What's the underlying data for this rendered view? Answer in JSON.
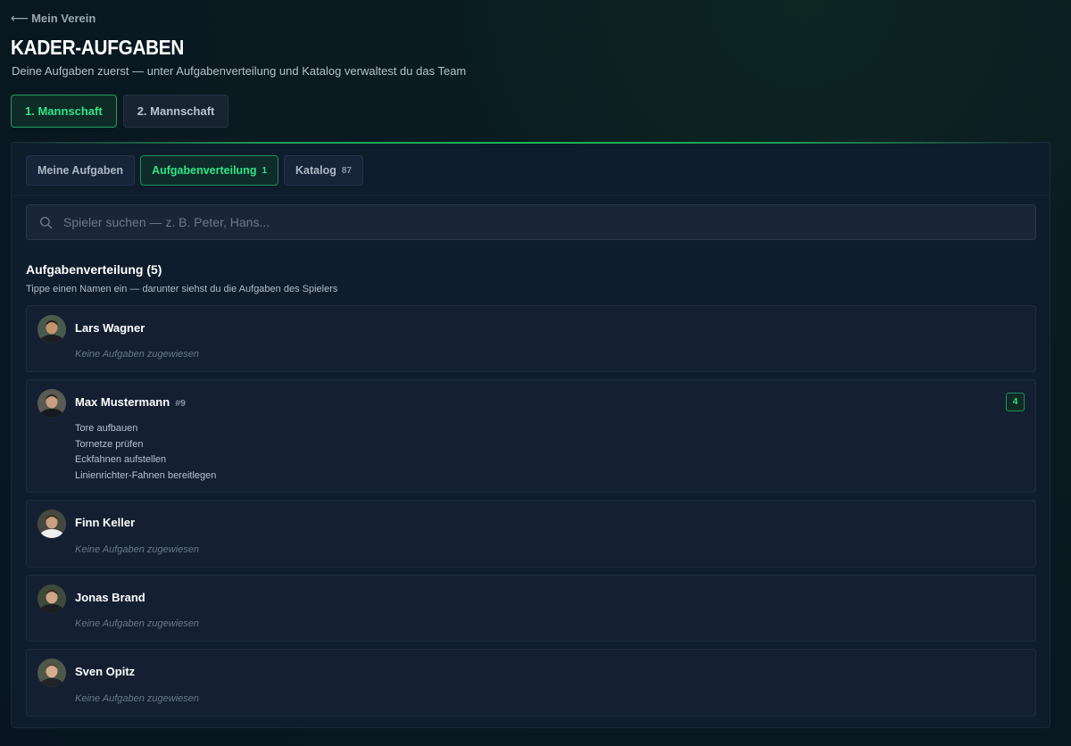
{
  "back_link": {
    "arrow": "⟵",
    "label": "Mein Verein"
  },
  "page": {
    "title": "KADER-AUFGABEN",
    "subtitle": "Deine Aufgaben zuerst — unter Aufgabenverteilung und Katalog verwaltest du das Team"
  },
  "team_tabs": [
    {
      "label": "1. Mannschaft",
      "active": true
    },
    {
      "label": "2. Mannschaft",
      "active": false
    }
  ],
  "sub_tabs": [
    {
      "label": "Meine Aufgaben",
      "count": "",
      "active": false
    },
    {
      "label": "Aufgabenverteilung",
      "count": "1",
      "active": true
    },
    {
      "label": "Katalog",
      "count": "87",
      "active": false
    }
  ],
  "search": {
    "placeholder": "Spieler suchen — z. B. Peter, Hans...",
    "value": "",
    "icon": "search-icon"
  },
  "section": {
    "title": "Aufgabenverteilung (5)",
    "hint": "Tippe einen Namen ein — darunter siehst du die Aufgaben des Spielers"
  },
  "empty_text": "Keine Aufgaben zugewiesen",
  "players": [
    {
      "name": "Lars Wagner",
      "number": "",
      "task_count": "",
      "tasks": []
    },
    {
      "name": "Max Mustermann",
      "number": "#9",
      "task_count": "4",
      "tasks": [
        "Tore aufbauen",
        "Tornetze prüfen",
        "Eckfahnen aufstellen",
        "Linienrichter-Fahnen bereitlegen"
      ]
    },
    {
      "name": "Finn Keller",
      "number": "",
      "task_count": "",
      "tasks": []
    },
    {
      "name": "Jonas Brand",
      "number": "",
      "task_count": "",
      "tasks": []
    },
    {
      "name": "Sven Opitz",
      "number": "",
      "task_count": "",
      "tasks": []
    }
  ],
  "colors": {
    "accent": "#2ee687",
    "accent_border": "#1d8f5c",
    "panel_bg": "#0f1c2b",
    "card_bg": "#142032"
  }
}
